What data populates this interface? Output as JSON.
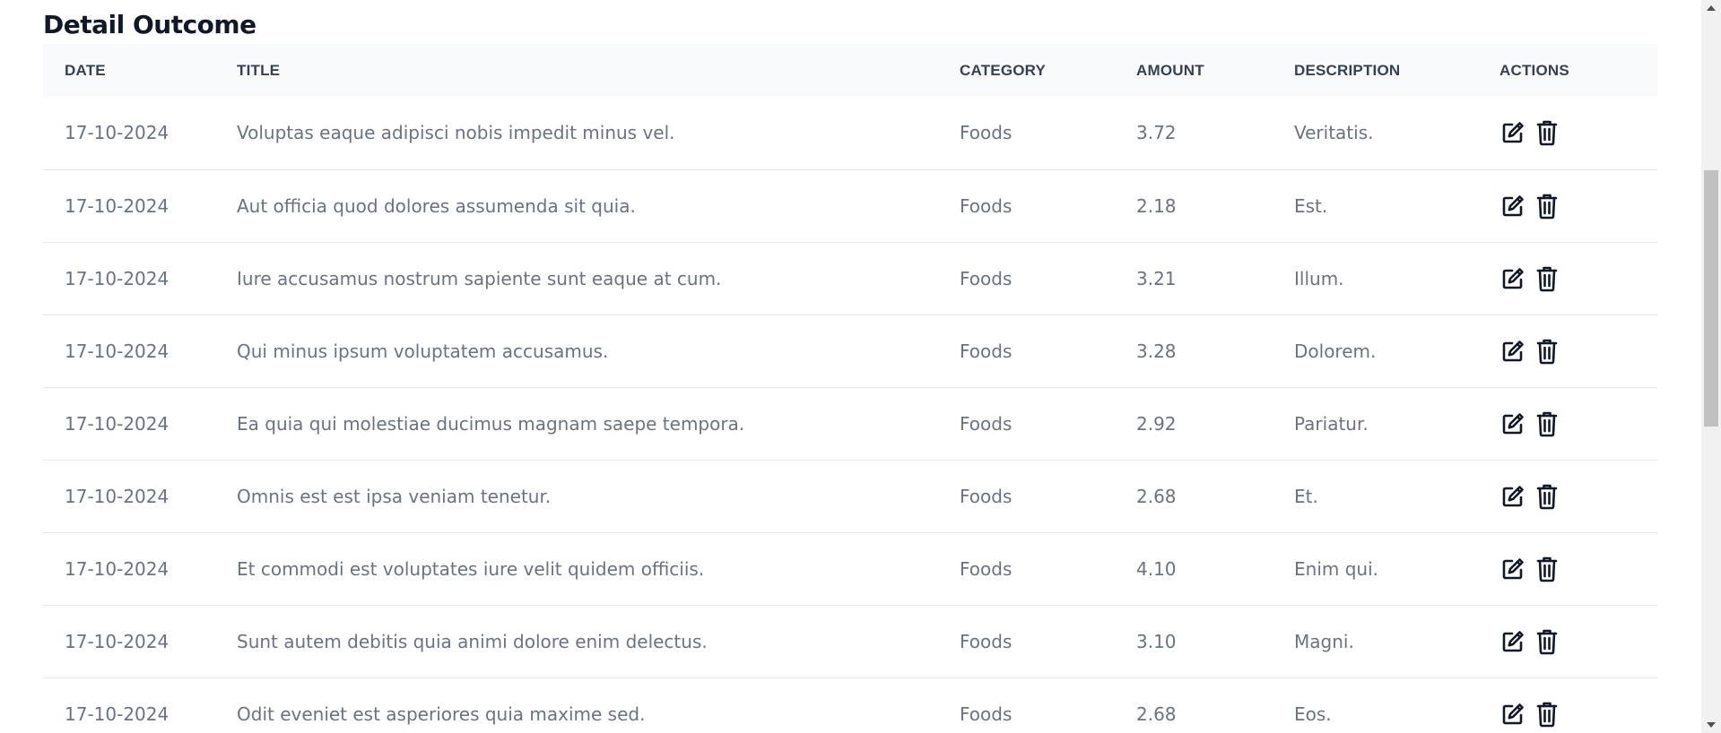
{
  "section": {
    "title": "Detail Outcome"
  },
  "table": {
    "headers": {
      "date": "DATE",
      "title": "TITLE",
      "category": "CATEGORY",
      "amount": "AMOUNT",
      "description": "DESCRIPTION",
      "actions": "ACTIONS"
    },
    "rows": [
      {
        "date": "17-10-2024",
        "title": "Voluptas eaque adipisci nobis impedit minus vel.",
        "category": "Foods",
        "amount": "3.72",
        "description": "Veritatis."
      },
      {
        "date": "17-10-2024",
        "title": "Aut officia quod dolores assumenda sit quia.",
        "category": "Foods",
        "amount": "2.18",
        "description": "Est."
      },
      {
        "date": "17-10-2024",
        "title": "Iure accusamus nostrum sapiente sunt eaque at cum.",
        "category": "Foods",
        "amount": "3.21",
        "description": "Illum."
      },
      {
        "date": "17-10-2024",
        "title": "Qui minus ipsum voluptatem accusamus.",
        "category": "Foods",
        "amount": "3.28",
        "description": "Dolorem."
      },
      {
        "date": "17-10-2024",
        "title": "Ea quia qui molestiae ducimus magnam saepe tempora.",
        "category": "Foods",
        "amount": "2.92",
        "description": "Pariatur."
      },
      {
        "date": "17-10-2024",
        "title": "Omnis est est ipsa veniam tenetur.",
        "category": "Foods",
        "amount": "2.68",
        "description": "Et."
      },
      {
        "date": "17-10-2024",
        "title": "Et commodi est voluptates iure velit quidem officiis.",
        "category": "Foods",
        "amount": "4.10",
        "description": "Enim qui."
      },
      {
        "date": "17-10-2024",
        "title": "Sunt autem debitis quia animi dolore enim delectus.",
        "category": "Foods",
        "amount": "3.10",
        "description": "Magni."
      },
      {
        "date": "17-10-2024",
        "title": "Odit eveniet est asperiores quia maxime sed.",
        "category": "Foods",
        "amount": "2.68",
        "description": "Eos."
      }
    ],
    "row_actions": [
      "edit-icon",
      "trash-icon"
    ]
  },
  "colors": {
    "heading": "#111827",
    "header_bg": "#f9fafb",
    "header_text": "#374151",
    "cell_text": "#6b7280",
    "row_border": "#e5e7eb",
    "icon": "#111827"
  }
}
